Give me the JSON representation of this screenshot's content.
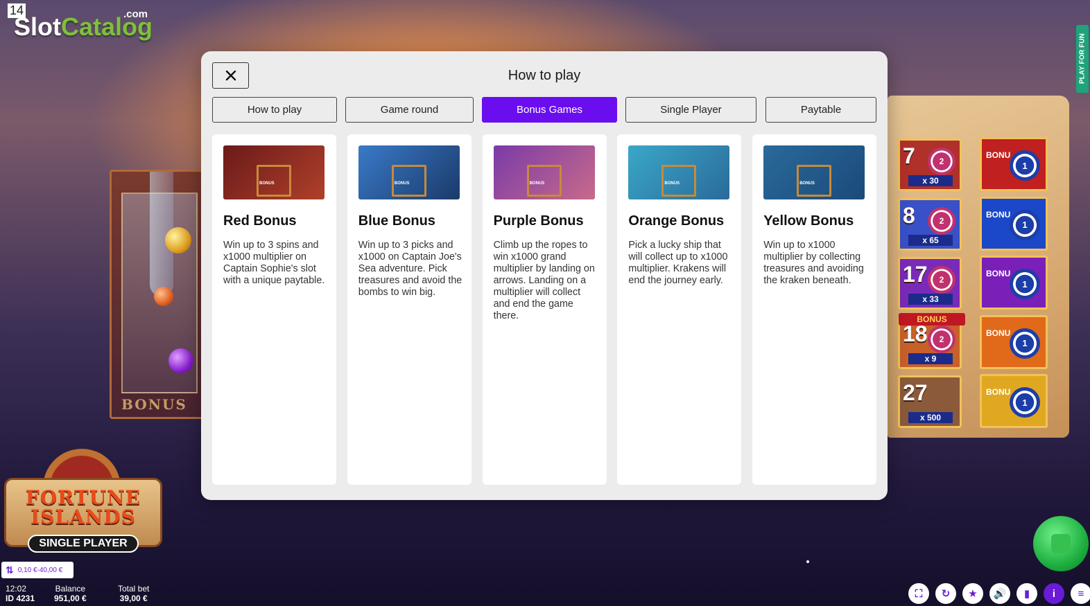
{
  "watermark": {
    "number": "14",
    "text_a": "Slot",
    "text_b": "Catalog",
    "suffix": ".com"
  },
  "game": {
    "logo_line1": "FORTUNE",
    "logo_line2": "ISLANDS",
    "mode_badge": "SINGLE PLAYER",
    "tower_label": "BONUS",
    "play_for_fun": "PLAY FOR FUN"
  },
  "board": {
    "number_tiles": [
      {
        "num": "7",
        "mult": "x 30",
        "chip": "2",
        "color": "#b0302a"
      },
      {
        "num": "8",
        "mult": "x 65",
        "chip": "2",
        "color": "#3850c8"
      },
      {
        "num": "17",
        "mult": "x 33",
        "chip": "2",
        "color": "#7a2ab8"
      },
      {
        "num": "18",
        "mult": "x 9",
        "chip": "2",
        "color": "#c8602a"
      },
      {
        "num": "27",
        "mult": "x 500",
        "chip": "",
        "color": "#8a5a3a"
      }
    ],
    "bonus_ribbon": "BONUS",
    "bonus_tiles": [
      {
        "label": "BONU",
        "chip": "1",
        "color": "#c02020"
      },
      {
        "label": "BONU",
        "chip": "1",
        "color": "#1a48c8"
      },
      {
        "label": "BONU",
        "chip": "1",
        "color": "#7a20b8"
      },
      {
        "label": "BONU",
        "chip": "1",
        "color": "#e06a1a"
      },
      {
        "label": "BONU",
        "chip": "1",
        "color": "#e0a820"
      }
    ]
  },
  "modal": {
    "title": "How to play",
    "close_icon": "close-icon",
    "tabs": [
      {
        "label": "How to play",
        "active": false
      },
      {
        "label": "Game round",
        "active": false
      },
      {
        "label": "Bonus Games",
        "active": true
      },
      {
        "label": "Single Player",
        "active": false
      },
      {
        "label": "Paytable",
        "active": false
      }
    ],
    "cards": [
      {
        "title": "Red Bonus",
        "description": "Win up to 3 spins and x1000 multiplier on Captain Sophie's slot with a unique paytable.",
        "image_label": "BONUS",
        "image_colors": [
          "#6a1a1a",
          "#b0402a"
        ]
      },
      {
        "title": "Blue Bonus",
        "description": "Win up to 3 picks and x1000 on Captain Joe's Sea adventure. Pick treasures and avoid the bombs to win big.",
        "image_label": "BONUS",
        "image_colors": [
          "#3a7ac8",
          "#1a3a6a"
        ]
      },
      {
        "title": "Purple Bonus",
        "description": "Climb up the ropes to win x1000 grand multiplier by landing on arrows. Landing on a multiplier will collect and end the game there.",
        "image_label": "BONUS",
        "image_colors": [
          "#7a3aa8",
          "#c86a8a"
        ]
      },
      {
        "title": "Orange Bonus",
        "description": "Pick a lucky ship that will collect up to x1000 multiplier. Krakens will end the journey early.",
        "image_label": "BONUS",
        "image_colors": [
          "#3aa8c8",
          "#2a6a9a"
        ]
      },
      {
        "title": "Yellow Bonus",
        "description": "Win up to x1000 multiplier by collecting treasures and avoiding the kraken beneath.",
        "image_label": "BONUS",
        "image_colors": [
          "#2a6a9a",
          "#1a4a7a"
        ]
      }
    ]
  },
  "footer": {
    "bet_range": "0,10 €-40,00 €",
    "time": "12:02",
    "id": "ID 4231",
    "balance_label": "Balance",
    "balance_value": "951,00 €",
    "total_bet_label": "Total bet",
    "total_bet_value": "39,00 €"
  },
  "toolbar": {
    "icons": [
      "fullscreen-icon",
      "autoplay-icon",
      "favorite-icon",
      "sound-icon",
      "stats-icon",
      "info-icon",
      "menu-icon"
    ],
    "glyphs": [
      "⛶",
      "↻",
      "★",
      "🔊",
      "▮",
      "i",
      "≡"
    ],
    "active_index": 5
  },
  "colors": {
    "accent": "#6a0ef0",
    "modal_bg": "#ececec",
    "card_bg": "#ffffff"
  }
}
